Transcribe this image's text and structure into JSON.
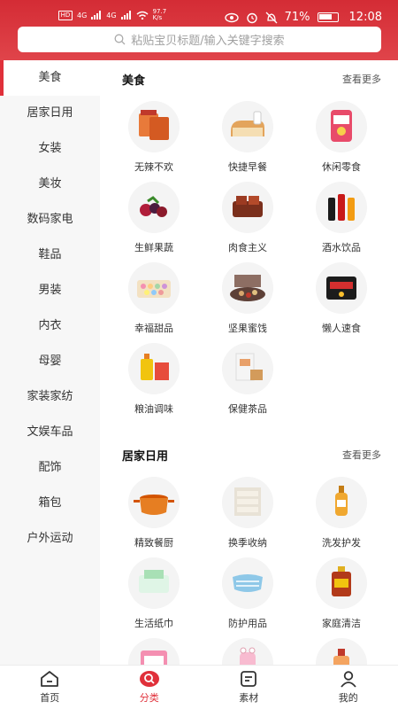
{
  "status": {
    "left_icons": [
      "HD",
      "4G",
      "4G"
    ],
    "speed": "97.7\nK/s",
    "battery": "71%",
    "time": "12:08"
  },
  "search": {
    "placeholder": "粘贴宝贝标题/输入关键字搜索"
  },
  "sidebar": {
    "items": [
      {
        "label": "美食",
        "active": true
      },
      {
        "label": "居家日用"
      },
      {
        "label": "女装"
      },
      {
        "label": "美妆"
      },
      {
        "label": "数码家电"
      },
      {
        "label": "鞋品"
      },
      {
        "label": "男装"
      },
      {
        "label": "内衣"
      },
      {
        "label": "母婴"
      },
      {
        "label": "家装家纺"
      },
      {
        "label": "文娱车品"
      },
      {
        "label": "配饰"
      },
      {
        "label": "箱包"
      },
      {
        "label": "户外运动"
      }
    ]
  },
  "sections": [
    {
      "title": "美食",
      "more": "查看更多",
      "items": [
        {
          "label": "无辣不欢",
          "icon": "snack-pack-icon"
        },
        {
          "label": "快捷早餐",
          "icon": "bread-icon"
        },
        {
          "label": "休闲零食",
          "icon": "chips-bag-icon"
        },
        {
          "label": "生鲜果蔬",
          "icon": "berries-icon"
        },
        {
          "label": "肉食主义",
          "icon": "meat-icon"
        },
        {
          "label": "酒水饮品",
          "icon": "bottles-icon"
        },
        {
          "label": "幸福甜品",
          "icon": "macaron-icon"
        },
        {
          "label": "坚果蜜饯",
          "icon": "nut-box-icon"
        },
        {
          "label": "懒人速食",
          "icon": "noodle-pack-icon"
        },
        {
          "label": "粮油调味",
          "icon": "oil-bottle-icon"
        },
        {
          "label": "保健茶品",
          "icon": "tea-box-icon"
        }
      ]
    },
    {
      "title": "居家日用",
      "more": "查看更多",
      "items": [
        {
          "label": "精致餐厨",
          "icon": "pot-icon"
        },
        {
          "label": "换季收纳",
          "icon": "storage-drawer-icon"
        },
        {
          "label": "洗发护发",
          "icon": "shampoo-icon"
        },
        {
          "label": "生活纸巾",
          "icon": "tissue-icon"
        },
        {
          "label": "防护用品",
          "icon": "mask-icon"
        },
        {
          "label": "家庭清洁",
          "icon": "cleaner-bottle-icon"
        },
        {
          "label": "",
          "icon": "pad-pack-icon"
        },
        {
          "label": "",
          "icon": "cup-icon"
        },
        {
          "label": "",
          "icon": "perfume-icon"
        }
      ]
    }
  ],
  "tabbar": {
    "items": [
      {
        "label": "首页",
        "icon": "home-icon"
      },
      {
        "label": "分类",
        "icon": "category-search-icon",
        "active": true
      },
      {
        "label": "素材",
        "icon": "material-icon"
      },
      {
        "label": "我的",
        "icon": "user-icon"
      }
    ]
  },
  "colors": {
    "brand_red": "#e0303a",
    "header_red": "#d42c35"
  }
}
